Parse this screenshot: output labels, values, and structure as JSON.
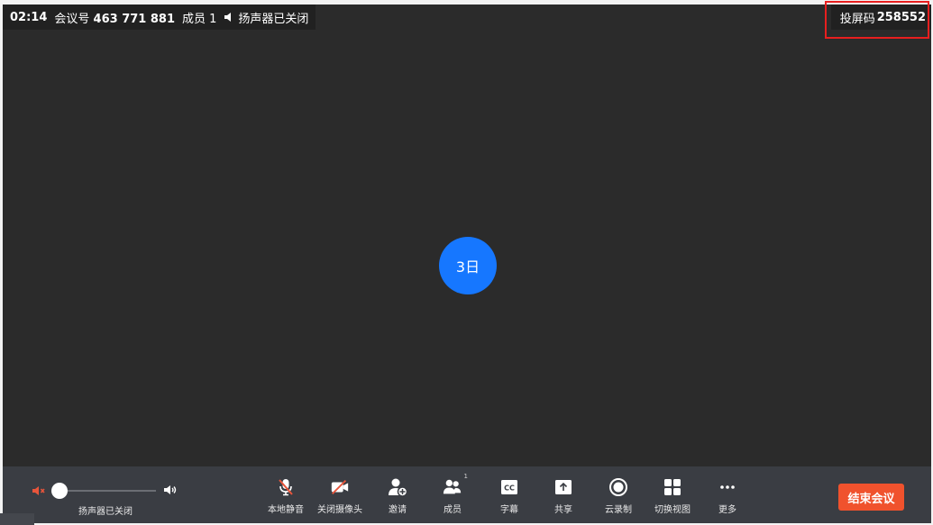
{
  "topbar": {
    "time": "02:14",
    "meeting_label": "会议号",
    "meeting_id": "463 771 881",
    "members_text": "成员 1",
    "speaker_status": "扬声器已关闭",
    "screen_code_label": "投屏码",
    "screen_code": "258552"
  },
  "participant": {
    "avatar_text": "3日",
    "avatar_color": "#1677ff"
  },
  "toolbar": {
    "volume_label": "扬声器已关闭",
    "volume_level": 0,
    "buttons": [
      {
        "label": "本地静音",
        "icon": "mic-off-icon"
      },
      {
        "label": "关闭摄像头",
        "icon": "camera-off-icon"
      },
      {
        "label": "邀请",
        "icon": "invite-icon"
      },
      {
        "label": "成员",
        "icon": "members-icon",
        "badge": "1"
      },
      {
        "label": "字幕",
        "icon": "captions-icon"
      },
      {
        "label": "共享",
        "icon": "share-icon"
      },
      {
        "label": "云录制",
        "icon": "record-icon"
      },
      {
        "label": "切换视图",
        "icon": "grid-view-icon"
      },
      {
        "label": "更多",
        "icon": "more-icon"
      }
    ],
    "end_label": "结束会议",
    "end_color": "#f0522d"
  },
  "colors": {
    "muted_red": "#e8553b",
    "highlight_box": "#e81f1f"
  }
}
